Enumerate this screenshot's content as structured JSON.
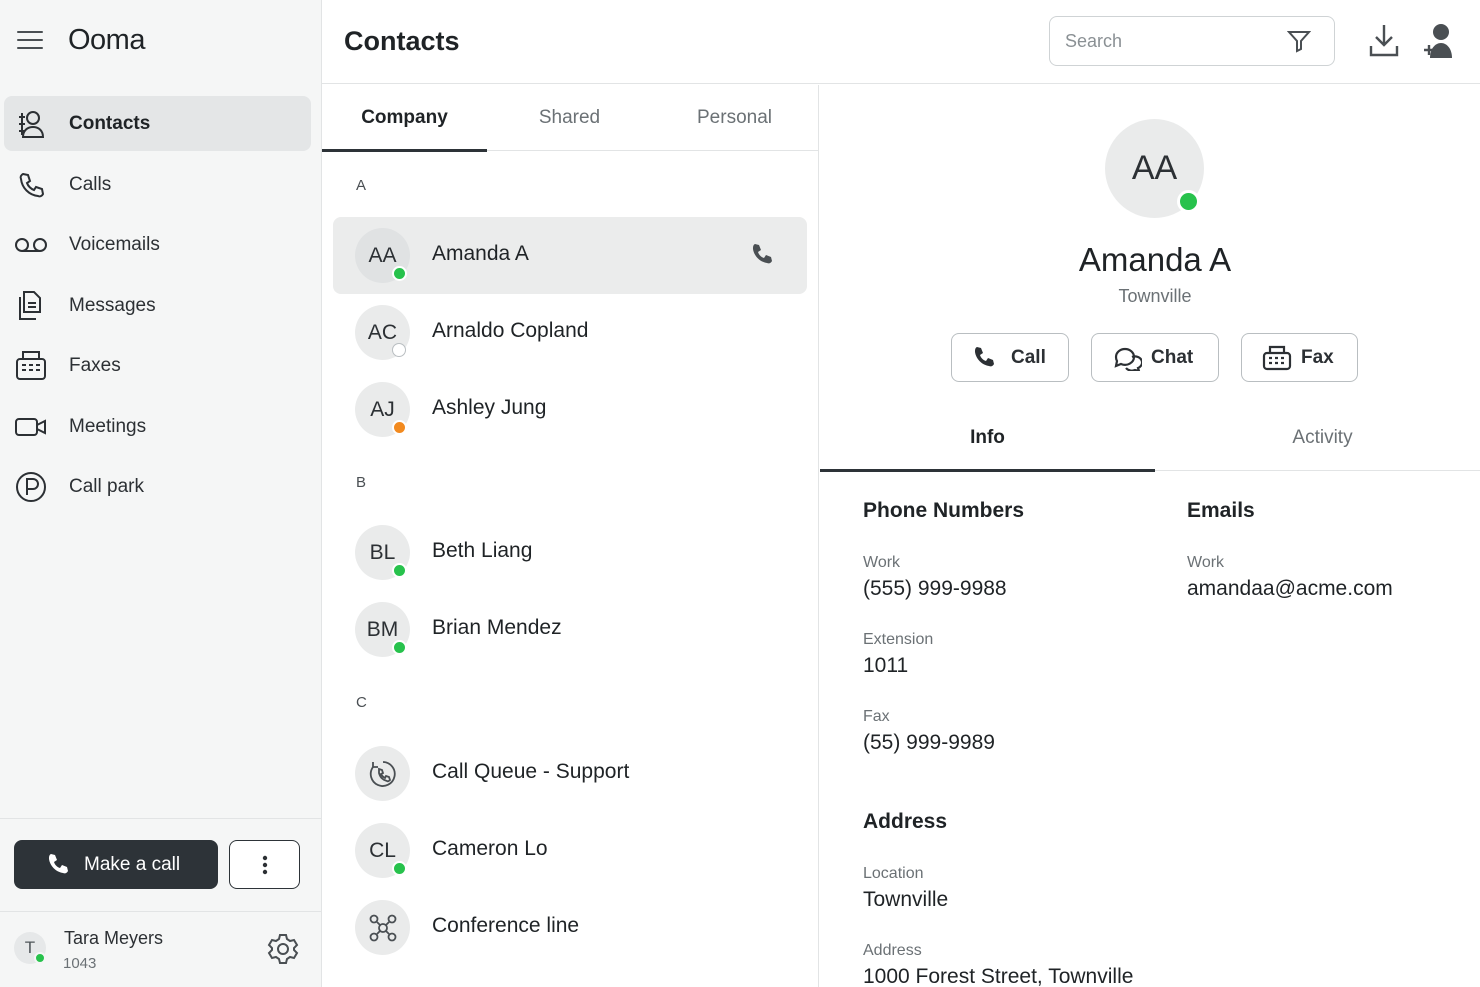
{
  "app": {
    "brand": "Ooma",
    "page_title": "Contacts"
  },
  "sidebar": {
    "items": [
      {
        "label": "Contacts",
        "icon": "contacts-icon",
        "active": true
      },
      {
        "label": "Calls",
        "icon": "phone-icon"
      },
      {
        "label": "Voicemails",
        "icon": "voicemail-icon"
      },
      {
        "label": "Messages",
        "icon": "messages-icon"
      },
      {
        "label": "Faxes",
        "icon": "fax-icon"
      },
      {
        "label": "Meetings",
        "icon": "video-icon"
      },
      {
        "label": "Call park",
        "icon": "park-icon"
      }
    ],
    "make_call_label": "Make a call",
    "user": {
      "initial": "T",
      "name": "Tara Meyers",
      "extension": "1043",
      "status": "online"
    }
  },
  "header": {
    "search_placeholder": "Search"
  },
  "list": {
    "tabs": [
      "Company",
      "Shared",
      "Personal"
    ],
    "active_tab": "Company",
    "sections": [
      {
        "letter": "A",
        "contacts": [
          {
            "initials": "AA",
            "name": "Amanda A",
            "status": "online",
            "selected": true
          },
          {
            "initials": "AC",
            "name": "Arnaldo Copland",
            "status": "offline"
          },
          {
            "initials": "AJ",
            "name": "Ashley Jung",
            "status": "away"
          }
        ]
      },
      {
        "letter": "B",
        "contacts": [
          {
            "initials": "BL",
            "name": "Beth Liang",
            "status": "online"
          },
          {
            "initials": "BM",
            "name": "Brian Mendez",
            "status": "online"
          }
        ]
      },
      {
        "letter": "C",
        "contacts": [
          {
            "initials": "",
            "name": "Call Queue - Support",
            "icon": "call-queue-icon"
          },
          {
            "initials": "CL",
            "name": "Cameron Lo",
            "status": "online"
          },
          {
            "initials": "",
            "name": "Conference line",
            "icon": "conference-icon"
          }
        ]
      }
    ]
  },
  "detail": {
    "initials": "AA",
    "name": "Amanda A",
    "subtitle": "Townville",
    "actions": {
      "call": "Call",
      "chat": "Chat",
      "fax": "Fax"
    },
    "tabs": [
      "Info",
      "Activity"
    ],
    "active_tab": "Info",
    "phone_numbers": {
      "title": "Phone Numbers",
      "work_label": "Work",
      "work_value": "(555) 999-9988",
      "extension_label": "Extension",
      "extension_value": "1011",
      "fax_label": "Fax",
      "fax_value": "(55) 999-9989"
    },
    "emails": {
      "title": "Emails",
      "work_label": "Work",
      "work_value": "amandaa@acme.com"
    },
    "address": {
      "title": "Address",
      "location_label": "Location",
      "location_value": "Townville",
      "address_label": "Address",
      "address_value": "1000 Forest Street, Townville"
    }
  },
  "colors": {
    "online": "#27c24c",
    "away": "#f28a1f",
    "primary_dark": "#2d3338"
  }
}
